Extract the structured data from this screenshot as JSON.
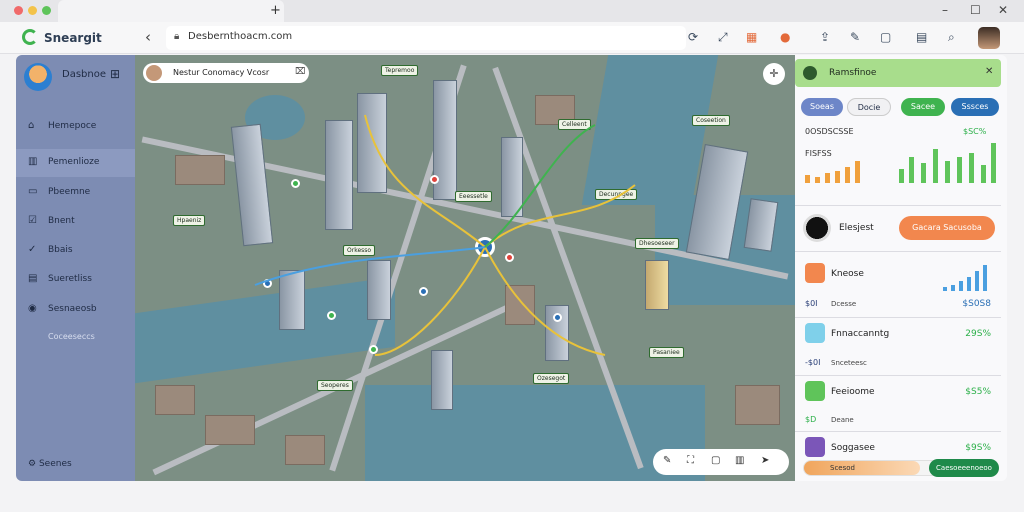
{
  "nav": {
    "brand": "Sneargit",
    "url": "Desbernthoacm.com"
  },
  "sidebar": {
    "title": "Dasbnoe",
    "items": [
      {
        "label": "Hemepoce"
      },
      {
        "label": "Pemenlioze"
      },
      {
        "label": "Pbeemne"
      },
      {
        "label": "Bnent"
      },
      {
        "label": "Bbais"
      },
      {
        "label": "Sueretliss"
      },
      {
        "label": "Sesnaeosb"
      }
    ],
    "sub_label": "Coceeseccs",
    "settings_label": "Seenes"
  },
  "map": {
    "search_text": "Nestur Conomacy Vcosr",
    "labels": [
      "Tepremoo",
      "Celleent",
      "Coseetion",
      "Eeessetle",
      "Decunpgee",
      "Hpaeniz",
      "Orkesso",
      "Dhesoeseer",
      "Pasaniee",
      "Seoperes",
      "Ozesegot"
    ]
  },
  "panel": {
    "header_title": "Ramsfinoe",
    "chips": [
      "Soeas",
      "Docie",
      "Sacee",
      "Sssces"
    ],
    "chart_label_1": "0OSDSCSSE",
    "chart_value_1": "$SC%",
    "chart_label_2": "FISFSS",
    "user_name": "Elesjest",
    "user_button": "Gacara Sacusoba",
    "rows": [
      {
        "title": "Kneose",
        "sub": "$0I",
        "sub2": "Dcesse",
        "value": "$S0S8",
        "color": "#2a6fb5"
      },
      {
        "title": "Fnnaccanntg",
        "sub": "-$0I",
        "sub2": "Snceteesc",
        "value": "29S%",
        "color": "#2db04a"
      },
      {
        "title": "Feeioome",
        "sub": "$D",
        "sub2": "Deane",
        "value": "$S5%",
        "color": "#2db04a"
      },
      {
        "title": "Soggasee",
        "sub": "",
        "sub2": "",
        "value": "$9S%",
        "color": "#2db04a"
      }
    ],
    "progress_text": "Scesod",
    "progress_mid": "",
    "progress_value": 0.6,
    "action_button": "Caesoeeenoeoo"
  }
}
